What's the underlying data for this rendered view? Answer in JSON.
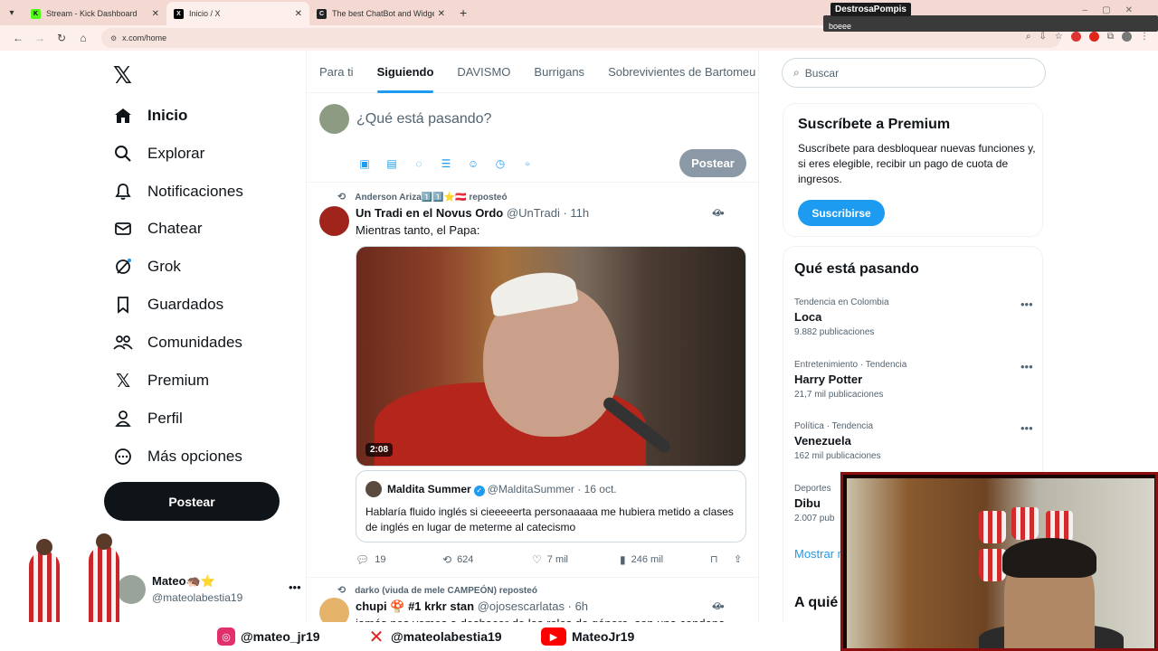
{
  "browser": {
    "tabs": [
      {
        "label": "Stream - Kick Dashboard",
        "favicon_color": "#53fc18",
        "favicon_letter": "K",
        "active": false
      },
      {
        "label": "Inicio / X",
        "favicon_color": "#000000",
        "favicon_letter": "X",
        "active": true
      },
      {
        "label": "The best ChatBot and Widgets",
        "favicon_color": "#222222",
        "favicon_letter": "C",
        "active": false
      }
    ],
    "url": "x.com/home"
  },
  "stream_overlay": {
    "chat_name": "DestrosaPompis",
    "chat_message": "boeee"
  },
  "left_nav": {
    "items": [
      {
        "label": "Inicio",
        "icon": "home-icon"
      },
      {
        "label": "Explorar",
        "icon": "search-icon"
      },
      {
        "label": "Notificaciones",
        "icon": "bell-icon"
      },
      {
        "label": "Chatear",
        "icon": "mail-icon"
      },
      {
        "label": "Grok",
        "icon": "grok-icon"
      },
      {
        "label": "Guardados",
        "icon": "bookmark-icon"
      },
      {
        "label": "Comunidades",
        "icon": "people-icon"
      },
      {
        "label": "Premium",
        "icon": "x-icon"
      },
      {
        "label": "Perfil",
        "icon": "person-icon"
      },
      {
        "label": "Más opciones",
        "icon": "more-circle-icon"
      }
    ],
    "post_button": "Postear",
    "account": {
      "name": "Mateo🦔⭐",
      "handle": "@mateolabestia19"
    }
  },
  "feed": {
    "tabs": [
      "Para ti",
      "Siguiendo",
      "DAVISMO",
      "Burrigans",
      "Sobrevivientes de Bartomeu"
    ],
    "active_tab": "Siguiendo",
    "composer": {
      "placeholder": "¿Qué está pasando?",
      "post_button": "Postear"
    },
    "tweets": [
      {
        "repost_by": "Anderson Ariza1️⃣1️⃣⭐🇦🇹 reposteó",
        "name": "Un Tradi en el Novus Ordo",
        "handle": "@UnTradi",
        "time": "· 11h",
        "text": "Mientras tanto, el Papa:",
        "video_duration": "2:08",
        "quote": {
          "name": "Maldita Summer",
          "handle": "@MalditaSummer",
          "time": "· 16 oct.",
          "text": "Hablaría fluido inglés si cieeeeerta personaaaaa me hubiera metido a clases de inglés en lugar de meterme al catecismo"
        },
        "stats": {
          "replies": "19",
          "reposts": "624",
          "likes": "7 mil",
          "views": "246 mil"
        }
      },
      {
        "repost_by": "darko (viuda de mele CAMPEÓN) reposteó",
        "name": "chupi 🍄 #1 krkr stan",
        "handle": "@ojosescarlatas",
        "time": "· 6h",
        "text": "jamás nos vemos a deshacer de los roles de género, son una condena"
      }
    ]
  },
  "right_col": {
    "search_placeholder": "Buscar",
    "premium": {
      "title": "Suscríbete a Premium",
      "desc": "Suscríbete para desbloquear nuevas funciones y, si eres elegible, recibir un pago de cuota de ingresos.",
      "button": "Suscribirse"
    },
    "trends_title": "Qué está pasando",
    "trends": [
      {
        "context": "Tendencia en Colombia",
        "topic": "Loca",
        "posts": "9.882 publicaciones"
      },
      {
        "context": "Entretenimiento · Tendencia",
        "topic": "Harry Potter",
        "posts": "21,7 mil publicaciones"
      },
      {
        "context": "Política · Tendencia",
        "topic": "Venezuela",
        "posts": "162 mil publicaciones"
      },
      {
        "context": "Deportes",
        "topic": "Dibu",
        "posts": "2.007 pub"
      }
    ],
    "show_more": "Mostrar m",
    "who_to_follow": "A quié"
  },
  "socials": [
    {
      "label": "@mateo_jr19",
      "icon": "instagram-icon",
      "color": "#e1306c"
    },
    {
      "label": "@mateolabestia19",
      "icon": "x-icon",
      "color": "#e0241b"
    },
    {
      "label": "MateoJr19",
      "icon": "youtube-icon",
      "color": "#ff0000"
    }
  ]
}
